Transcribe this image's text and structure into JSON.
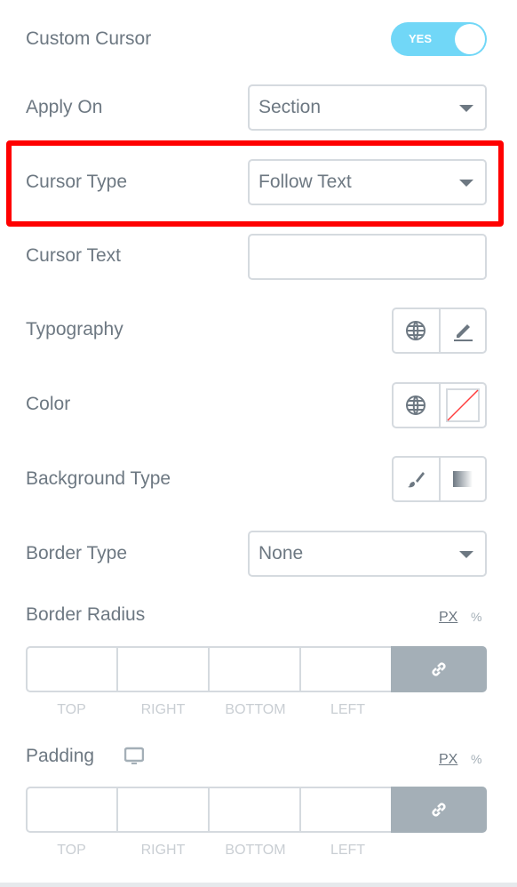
{
  "custom_cursor": {
    "label": "Custom Cursor",
    "toggle_label": "YES",
    "enabled": true,
    "accent": "#71d7f7"
  },
  "apply_on": {
    "label": "Apply On",
    "value": "Section"
  },
  "cursor_type": {
    "label": "Cursor Type",
    "value": "Follow Text",
    "highlight_color": "#ff0000"
  },
  "cursor_text": {
    "label": "Cursor Text",
    "value": ""
  },
  "typography": {
    "label": "Typography",
    "icons": [
      "globe-icon",
      "pencil-icon"
    ]
  },
  "color": {
    "label": "Color",
    "icons": [
      "globe-icon",
      "no-color-swatch-icon"
    ]
  },
  "background_type": {
    "label": "Background Type",
    "icons": [
      "brush-icon",
      "gradient-icon"
    ]
  },
  "border_type": {
    "label": "Border Type",
    "value": "None"
  },
  "border_radius": {
    "label": "Border Radius",
    "units": [
      "PX",
      "%"
    ],
    "fields": [
      "TOP",
      "RIGHT",
      "BOTTOM",
      "LEFT"
    ]
  },
  "padding": {
    "label": "Padding",
    "units": [
      "PX",
      "%"
    ],
    "fields": [
      "TOP",
      "RIGHT",
      "BOTTOM",
      "LEFT"
    ]
  }
}
